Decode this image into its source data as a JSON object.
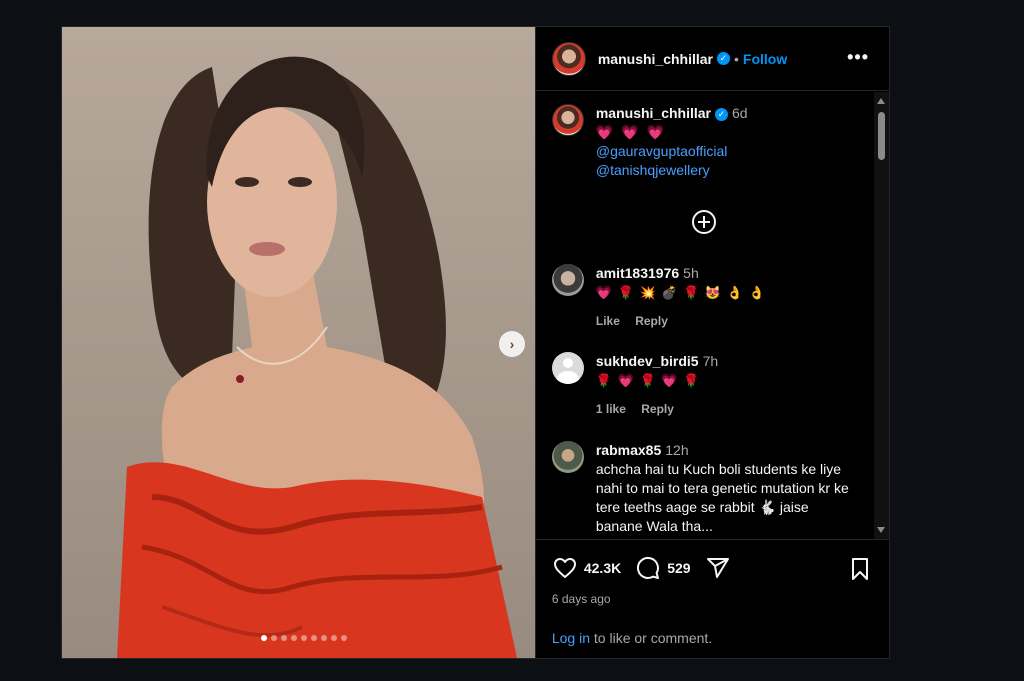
{
  "post": {
    "author": "manushi_chhillar",
    "follow_label": "Follow",
    "separator": "•",
    "more_label": "•••",
    "caption": {
      "username": "manushi_chhillar",
      "time": "6d",
      "hearts": "💗 💗 💗",
      "mentions": [
        "@gauravguptaofficial",
        "@tanishqjewellery"
      ]
    },
    "likes": "42.3K",
    "comments_count": "529",
    "posted_ago": "6 days ago",
    "login_link": "Log in",
    "login_text": " to like or comment.",
    "carousel": {
      "total": 9,
      "active_index": 0
    }
  },
  "comments": [
    {
      "username": "amit1831976",
      "time": "5h",
      "emojis": [
        "💗",
        "🌹",
        "💥",
        "💣",
        "🌹",
        "😻",
        "👌",
        "👌"
      ],
      "like_label": "Like",
      "reply_label": "Reply"
    },
    {
      "username": "sukhdev_birdi5",
      "time": "7h",
      "emojis": [
        "🌹",
        "💗",
        "🌹",
        "💗",
        "🌹"
      ],
      "like_label": "1 like",
      "reply_label": "Reply"
    },
    {
      "username": "rabmax85",
      "time": "12h",
      "text": "achcha hai tu Kuch boli students ke liye nahi to mai to tera genetic mutation kr ke tere teeths aage se rabbit 🐇 jaise banane Wala tha..."
    }
  ],
  "colors": {
    "background": "#0c1014",
    "link": "#0095f6",
    "text": "#f5f5f5",
    "muted": "#a8a8a8"
  }
}
